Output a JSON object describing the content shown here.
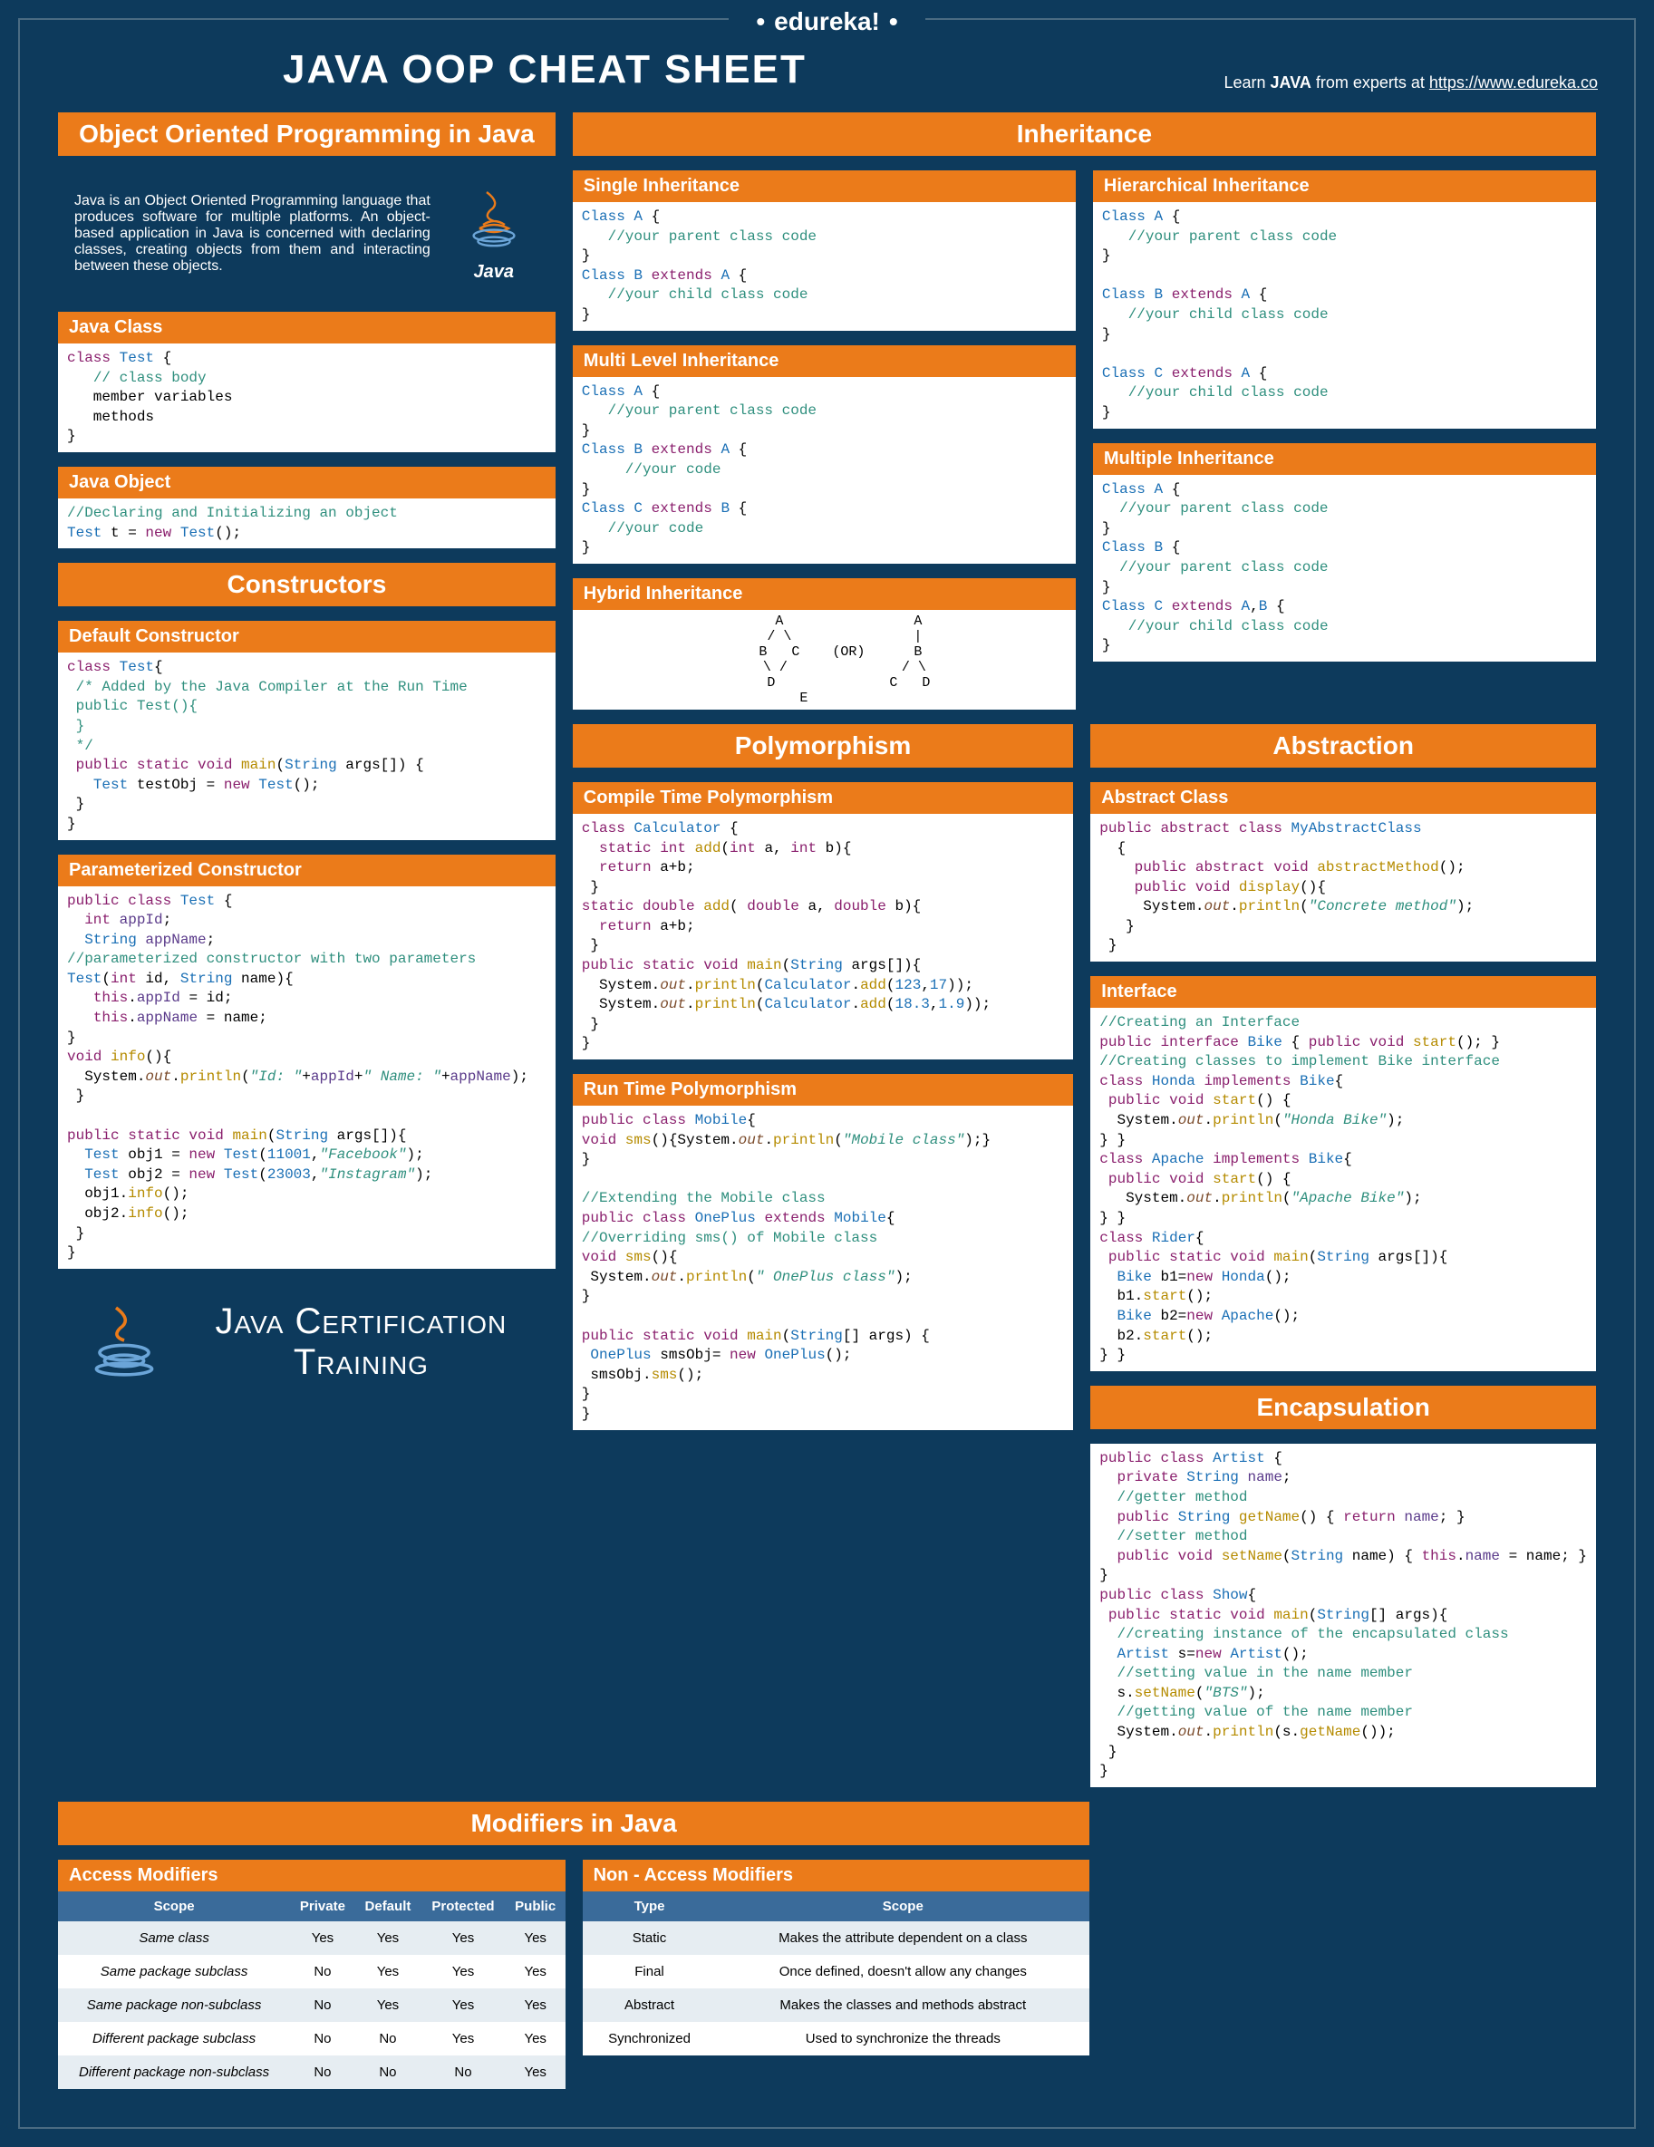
{
  "brand": "edureka!",
  "main_title": "JAVA OOP CHEAT SHEET",
  "learn_prefix": "Learn ",
  "learn_bold": "JAVA",
  "learn_suffix": " from experts at ",
  "learn_link": "https://www.edureka.co",
  "left": {
    "h_oop": "Object Oriented Programming in Java",
    "intro": "Java is an Object Oriented Programming language that produces software for multiple platforms. An object-based application in Java is concerned with declaring classes, creating objects from them and interacting between these objects.",
    "java_logo_label": "Java",
    "h_javaclass": "Java Class",
    "h_javaobject": "Java Object",
    "h_constructors": "Constructors",
    "h_defcon": "Default Constructor",
    "h_paramcon": "Parameterized Constructor",
    "cert_title": "Java Certification Training"
  },
  "modifiers": {
    "h": "Modifiers in Java",
    "h_access": "Access Modifiers",
    "h_nonaccess": "Non - Access Modifiers",
    "access_headers": [
      "Scope",
      "Private",
      "Default",
      "Protected",
      "Public"
    ],
    "access_rows": [
      [
        "Same class",
        "Yes",
        "Yes",
        "Yes",
        "Yes"
      ],
      [
        "Same package subclass",
        "No",
        "Yes",
        "Yes",
        "Yes"
      ],
      [
        "Same package non-subclass",
        "No",
        "Yes",
        "Yes",
        "Yes"
      ],
      [
        "Different package subclass",
        "No",
        "No",
        "Yes",
        "Yes"
      ],
      [
        "Different package non-subclass",
        "No",
        "No",
        "No",
        "Yes"
      ]
    ],
    "na_headers": [
      "Type",
      "Scope"
    ],
    "na_rows": [
      [
        "Static",
        "Makes the attribute dependent on a class"
      ],
      [
        "Final",
        "Once defined, doesn't allow any changes"
      ],
      [
        "Abstract",
        "Makes the classes and methods abstract"
      ],
      [
        "Synchronized",
        "Used to synchronize the threads"
      ]
    ]
  },
  "inh": {
    "h": "Inheritance",
    "single": "Single Inheritance",
    "multi": "Multi Level Inheritance",
    "hier": "Hierarchical Inheritance",
    "multiple": "Multiple Inheritance",
    "hybrid": "Hybrid Inheritance"
  },
  "poly": {
    "h": "Polymorphism",
    "compile": "Compile Time Polymorphism",
    "run": "Run Time Polymorphism"
  },
  "abs": {
    "h": "Abstraction",
    "absclass": "Abstract Class",
    "iface": "Interface"
  },
  "enc": {
    "h": "Encapsulation"
  }
}
